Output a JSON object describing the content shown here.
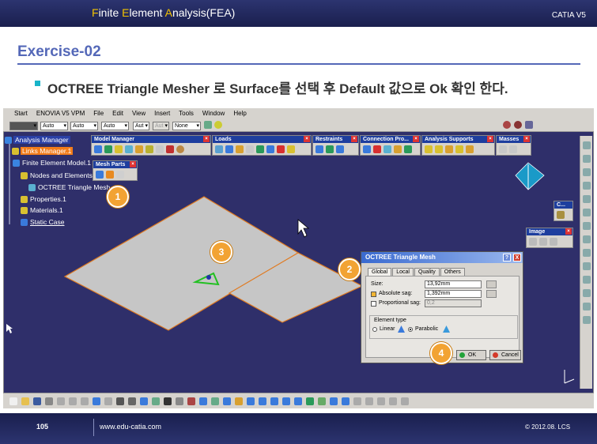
{
  "slide": {
    "header_title_parts": [
      "F",
      "inite ",
      "E",
      "lement ",
      "A",
      "nalysis(FEA)"
    ],
    "header_brand": "CATIA V5",
    "exercise_title": "Exercise-02",
    "instruction": "OCTREE Triangle Mesher 로 Surface를 선택 후 Default  값으로 Ok 확인 한다.",
    "page_number": "105",
    "url": "www.edu-catia.com",
    "copyright": "© 2012.08. LCS"
  },
  "menubar": [
    "Start",
    "ENOVIA V5 VPM",
    "File",
    "Edit",
    "View",
    "Insert",
    "Tools",
    "Window",
    "Help"
  ],
  "top_combos": [
    "",
    "Auto",
    "Auto",
    "Auto",
    "Aut",
    "Aut",
    "None"
  ],
  "toolbars": {
    "model_manager": "Model Manager",
    "mesh_parts": "Mesh Parts",
    "loads": "Loads",
    "restraints": "Restraints",
    "connection_pro": "Connection Pro...",
    "analysis_supports": "Analysis Supports",
    "masses": "Masses",
    "c": "C...",
    "image": "Image"
  },
  "tree": {
    "root": "Analysis Manager",
    "links": "Links Manager.1",
    "fem": "Finite Element Model.1",
    "nodes": "Nodes and Elements",
    "octree": "OCTREE Triangle Mesh",
    "properties": "Properties.1",
    "materials": "Materials.1",
    "static": "Static Case"
  },
  "dialog": {
    "title": "OCTREE Triangle Mesh",
    "help": "?",
    "close": "X",
    "tabs": [
      "Global",
      "Local",
      "Quality",
      "Others"
    ],
    "size_label": "Size:",
    "size_value": "13,92mm",
    "abs_sag_label": "Absolute sag:",
    "abs_sag_value": "1,392mm",
    "prop_sag_label": "Proportional sag:",
    "prop_sag_value": "0,2",
    "element_type_label": "Element type",
    "linear_label": "Linear",
    "parabolic_label": "Parabolic",
    "ok": "OK",
    "cancel": "Cancel"
  },
  "callouts": [
    "1",
    "2",
    "3",
    "4"
  ],
  "colors": {
    "accent_blue": "#5468b8",
    "header_bg": "#1a1f4e",
    "viewport_bg": "#2f2f6a",
    "callout": "#f2a333"
  }
}
